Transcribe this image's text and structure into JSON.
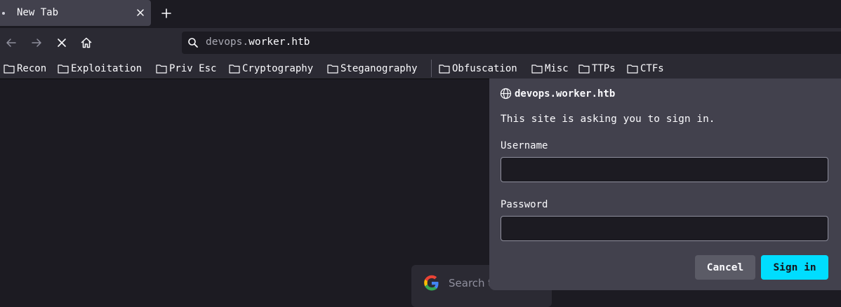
{
  "tab": {
    "title": "New Tab",
    "close_icon": "close-icon",
    "new_tab_icon": "plus-icon"
  },
  "nav": {
    "back_icon": "arrow-left-icon",
    "forward_icon": "arrow-right-icon",
    "stop_icon": "close-icon",
    "home_icon": "home-icon",
    "url_prefix": "devops.",
    "url_main": "worker.htb"
  },
  "bookmarks": [
    "Recon",
    "Exploitation",
    "Priv Esc",
    "Cryptography",
    "Steganography",
    "Obfuscation",
    "Misc",
    "TTPs",
    "CTFs"
  ],
  "search": {
    "placeholder": "Search t"
  },
  "dialog": {
    "host": "devops.worker.htb",
    "message": "This site is asking you to sign in.",
    "username_label": "Username",
    "password_label": "Password",
    "username_value": "",
    "password_value": "",
    "cancel_label": "Cancel",
    "signin_label": "Sign in"
  },
  "colors": {
    "accent": "#00ddff",
    "background": "#1c1b22",
    "toolbar": "#2b2a33",
    "panel": "#42414d"
  }
}
